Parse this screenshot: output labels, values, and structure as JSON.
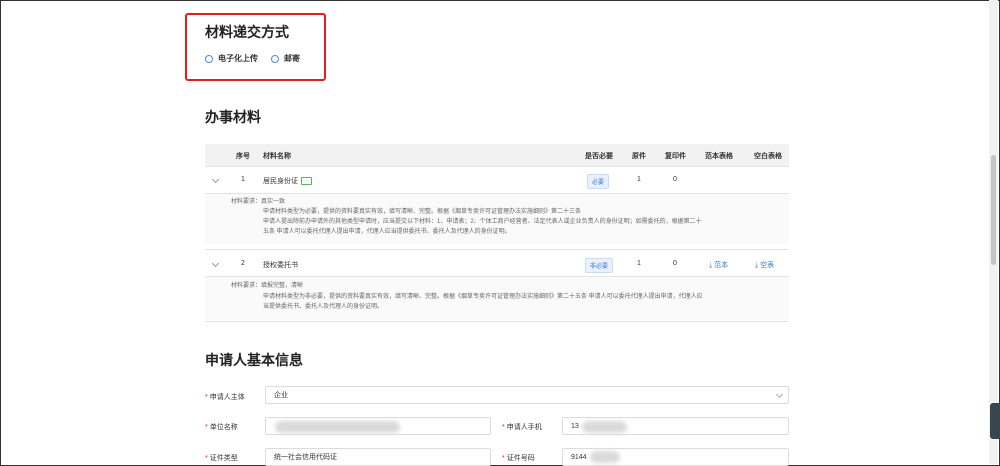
{
  "delivery": {
    "title": "材料递交方式",
    "options": [
      {
        "label": "电子化上传",
        "selected": false
      },
      {
        "label": "邮寄",
        "selected": false
      }
    ]
  },
  "materials": {
    "title": "办事材料",
    "headers": [
      "序号",
      "材料名称",
      "是否必要",
      "原件",
      "复印件",
      "范本表格",
      "空白表格"
    ],
    "rows": [
      {
        "index": "1",
        "name": "居民身份证",
        "required": "必要",
        "original": "1",
        "copy": "0",
        "template": "",
        "blank": "",
        "requirements": [
          "材料要求：真实一致",
          "申请材料类型为必要，提供的资料要真实有效，填写清晰、完整。根据《烟草专卖许可证管理办法实施细则》第二十三条",
          "申请人提出除前办申请外的其他类型申请时，应当提交以下材料：1、申请表；2、个体工商户经营者、法定代表人或企业负责人的身份证明；如需委托的，根据第二十",
          "五条 申请人可以委托代理人提出申请，代理人应当提供委托书、委托人及代理人的身份证明。"
        ]
      },
      {
        "index": "2",
        "name": "授权委托书",
        "required": "非必要",
        "original": "1",
        "copy": "0",
        "template": "范本",
        "blank": "空表",
        "requirements": [
          "材料要求：填报完整，清晰",
          "申请材料类型为非必要，提供的资料要真实有效，填写清晰、完整。根据《烟草专卖许可证管理办法实施细则》第二十五条 申请人可以委托代理人提出申请，代理人应",
          "当提供委托书、委托人及代理人的身份证明。"
        ]
      }
    ]
  },
  "applicant": {
    "title": "申请人基本信息",
    "subject_label": "申请人主体",
    "subject_value": "企业",
    "company_label": "单位名称",
    "company_value": "",
    "phone_label": "申请人手机",
    "phone_value": "13",
    "idtype_label": "证件类型",
    "idtype_value": "统一社会信用代码证",
    "idno_label": "证件号码",
    "idno_value": "9144"
  },
  "colors": {
    "accent": "#3a7bd5",
    "highlight": "#e02020"
  }
}
